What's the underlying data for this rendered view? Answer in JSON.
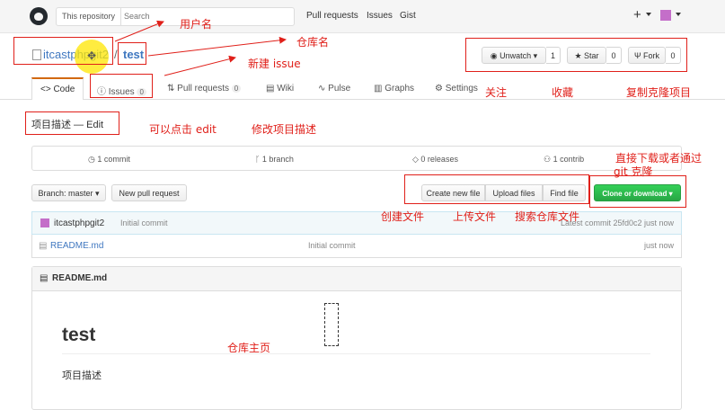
{
  "header": {
    "search_scope": "This repository",
    "search_placeholder": "Search",
    "nav": [
      "Pull requests",
      "Issues",
      "Gist"
    ],
    "plus": "+"
  },
  "repo": {
    "owner": "itcastphpgit2",
    "slash": "/",
    "name": "test"
  },
  "actions": {
    "watch_label": "Unwatch",
    "watch_count": "1",
    "star_label": "Star",
    "star_count": "0",
    "fork_label": "Fork",
    "fork_count": "0"
  },
  "tabs": {
    "code": "<> Code",
    "issues": "Issues",
    "issues_count": "0",
    "pulls": "Pull requests",
    "pulls_count": "0",
    "wiki": "Wiki",
    "pulse": "Pulse",
    "graphs": "Graphs",
    "settings": "Settings"
  },
  "description": {
    "text": "项目描述 — Edit"
  },
  "summary": {
    "commits": "1 commit",
    "branches": "1 branch",
    "releases": "0 releases",
    "contributors": "1 contrib"
  },
  "toolbar": {
    "branch": "Branch: master",
    "new_pr": "New pull request",
    "create_file": "Create new file",
    "upload_files": "Upload files",
    "find_file": "Find file",
    "clone": "Clone or download"
  },
  "commit": {
    "author": "itcastphpgit2",
    "message": "Initial commit",
    "latest": "Latest commit 25fd0c2 just now"
  },
  "files": [
    {
      "name": "README.md",
      "message": "Initial commit",
      "age": "just now"
    }
  ],
  "readme": {
    "header": "README.md",
    "title": "test",
    "body": "项目描述"
  },
  "annotations": {
    "username": "用户名",
    "repo_name": "仓库名",
    "new_issue": "新建 issue",
    "watch": "关注",
    "star": "收藏",
    "fork": "复制克隆项目",
    "edit": "可以点击 edit",
    "edit_desc": "修改项目描述",
    "download": "直接下载或者通过",
    "git_clone": "git 克隆",
    "create_file": "创建文件",
    "upload": "上传文件",
    "search": "搜索仓库文件",
    "home": "仓库主页"
  },
  "colors": {
    "annotation": "#e0201a",
    "link": "#4078c0",
    "clone_button": "#28a745"
  }
}
